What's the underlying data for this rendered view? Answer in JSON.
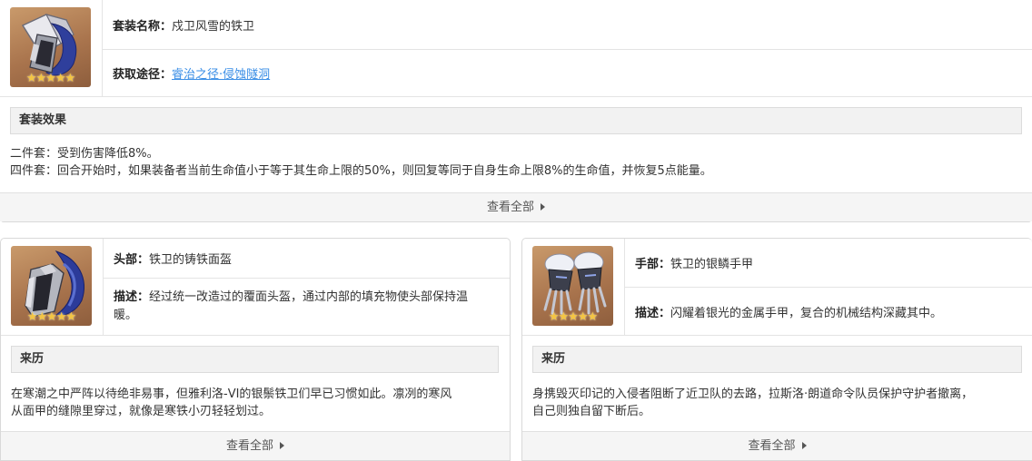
{
  "set": {
    "name_label": "套装名称：",
    "name_value": "戍卫风雪的铁卫",
    "source_label": "获取途径：",
    "source_link": "睿治之径·侵蚀隧洞",
    "rarity_stars": "★★★★★",
    "effect_title": "套装效果",
    "effect_2pc": "二件套：受到伤害降低8%。",
    "effect_4pc": "四件套：回合开始时，如果装备者当前生命值小于等于其生命上限的50%，则回复等同于自身生命上限8%的生命值，并恢复5点能量。",
    "view_all": "查看全部"
  },
  "head": {
    "slot_label": "头部：",
    "item_name": "铁卫的铸铁面盔",
    "desc_label": "描述：",
    "desc_line1": "经过统一改造过的覆面头盔，通过内部的填充物使头部保持温",
    "desc_line2": "暖。",
    "rarity_stars": "★★★★★",
    "lore_title": "来历",
    "lore_line1": "在寒潮之中严阵以待绝非易事，但雅利洛-VI的银鬃铁卫们早已习惯如此。凛冽的寒风",
    "lore_line2": "从面甲的缝隙里穿过，就像是寒铁小刃轻轻划过。",
    "view_all": "查看全部"
  },
  "hand": {
    "slot_label": "手部：",
    "item_name": "铁卫的银鳞手甲",
    "desc_label": "描述：",
    "desc_text": "闪耀着银光的金属手甲，复合的机械结构深藏其中。",
    "rarity_stars": "★★★★★",
    "lore_title": "来历",
    "lore_line1": "身携毁灭印记的入侵者阻断了近卫队的去路，拉斯洛·朗道命令队员保护守护者撤离，",
    "lore_line2": "自己则独自留下断后。",
    "view_all": "查看全部"
  }
}
